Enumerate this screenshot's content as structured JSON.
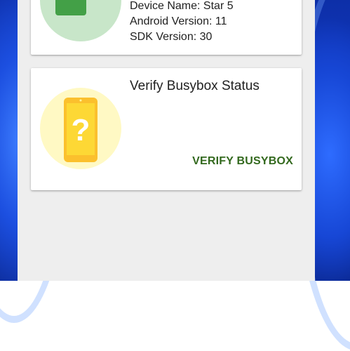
{
  "device_card": {
    "icon": "phone-check-icon",
    "device_name": "Device Name: Star 5",
    "android_version": "Android Version: 11",
    "sdk_version": "SDK Version: 30",
    "accent_color": "#43a047",
    "circle_color": "#c8e6c9"
  },
  "busybox_card": {
    "icon": "phone-question-icon",
    "title": "Verify Busybox Status",
    "action_label": "VERIFY BUSYBOX",
    "accent_color": "#fbc02d",
    "circle_color": "#fff9c4",
    "action_color": "#33691e"
  }
}
